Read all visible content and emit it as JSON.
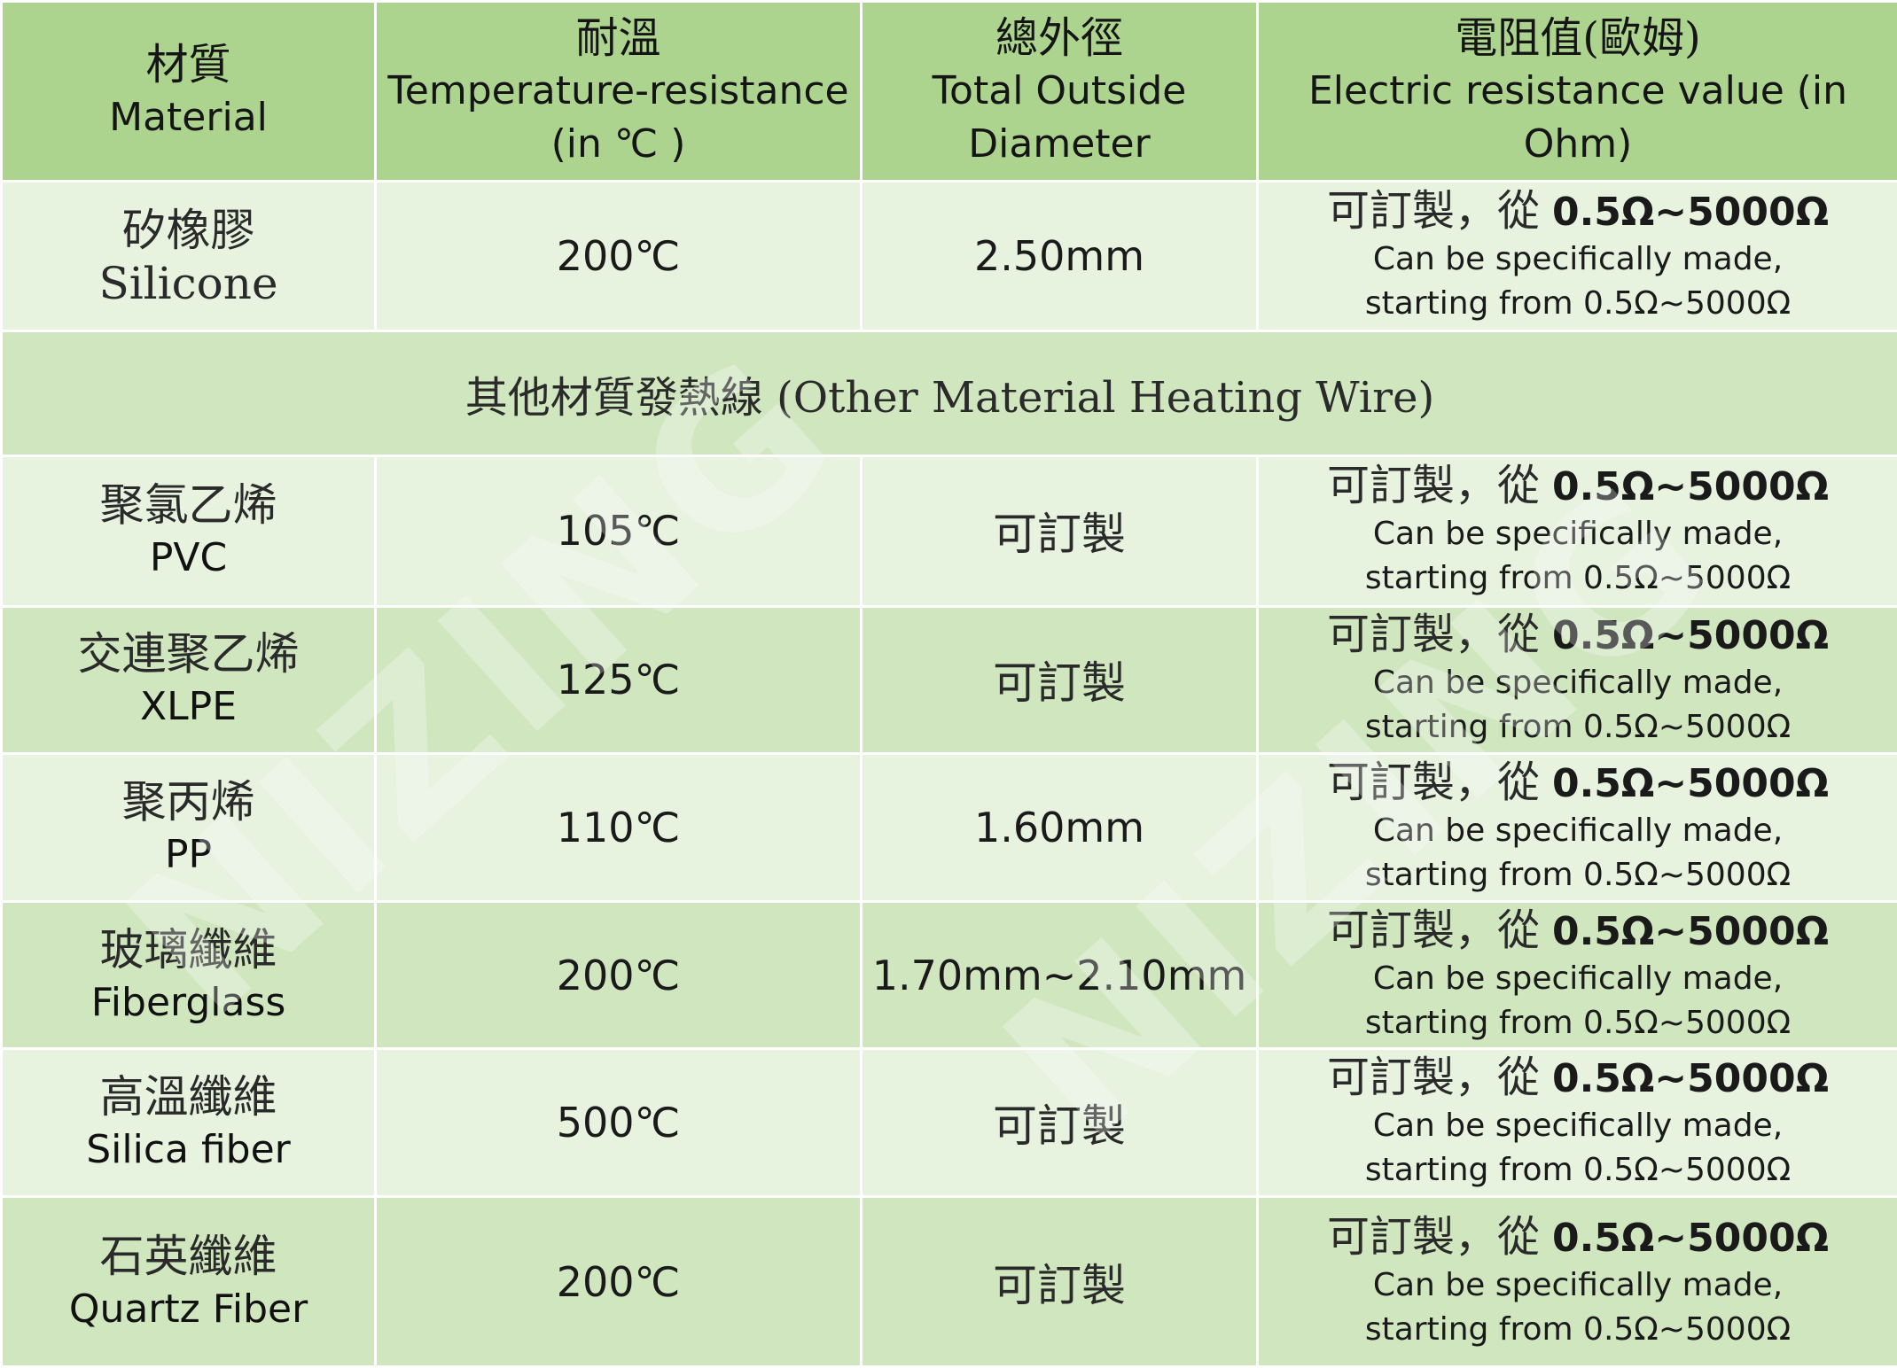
{
  "headers": [
    {
      "cn": "材質",
      "en": "Material"
    },
    {
      "cn": "耐溫",
      "en": "Temperature-resistance",
      "unit": "(in ℃ )"
    },
    {
      "cn": "總外徑",
      "en": "Total Outside",
      "en2": "Diameter"
    },
    {
      "cn": "電阻值(歐姆)",
      "en": "Electric resistance value (in Ohm)"
    }
  ],
  "resistance": {
    "cn": "可訂製，從",
    "range": "0.5Ω~5000Ω",
    "line2": "Can be specifically made,",
    "line3": "starting from 0.5Ω~5000Ω"
  },
  "section_title": "其他材質發熱線 (Other Material Heating Wire)",
  "rows": [
    {
      "material_cn": "矽橡膠",
      "material_en": "Silicone",
      "temp": "200℃",
      "diameter": "2.50mm"
    },
    {
      "material_cn": "聚氯乙烯",
      "material_en": "PVC",
      "temp": "105℃",
      "diameter": "可訂製"
    },
    {
      "material_cn": "交連聚乙烯",
      "material_en": "XLPE",
      "temp": "125℃",
      "diameter": "可訂製"
    },
    {
      "material_cn": "聚丙烯",
      "material_en": "PP",
      "temp": "110℃",
      "diameter": "1.60mm"
    },
    {
      "material_cn": "玻璃纖維",
      "material_en": "Fiberglass",
      "temp": "200℃",
      "diameter": "1.70mm~2.10mm"
    },
    {
      "material_cn": "高溫纖維",
      "material_en": "Silica fiber",
      "temp": "500℃",
      "diameter": "可訂製"
    },
    {
      "material_cn": "石英纖維",
      "material_en": "Quartz Fiber",
      "temp": "200℃",
      "diameter": "可訂製"
    }
  ],
  "watermark": "NIZING",
  "colors": {
    "header": "#acd48e",
    "row_light": "#e7f2df",
    "row_green": "#d0e6bf"
  }
}
